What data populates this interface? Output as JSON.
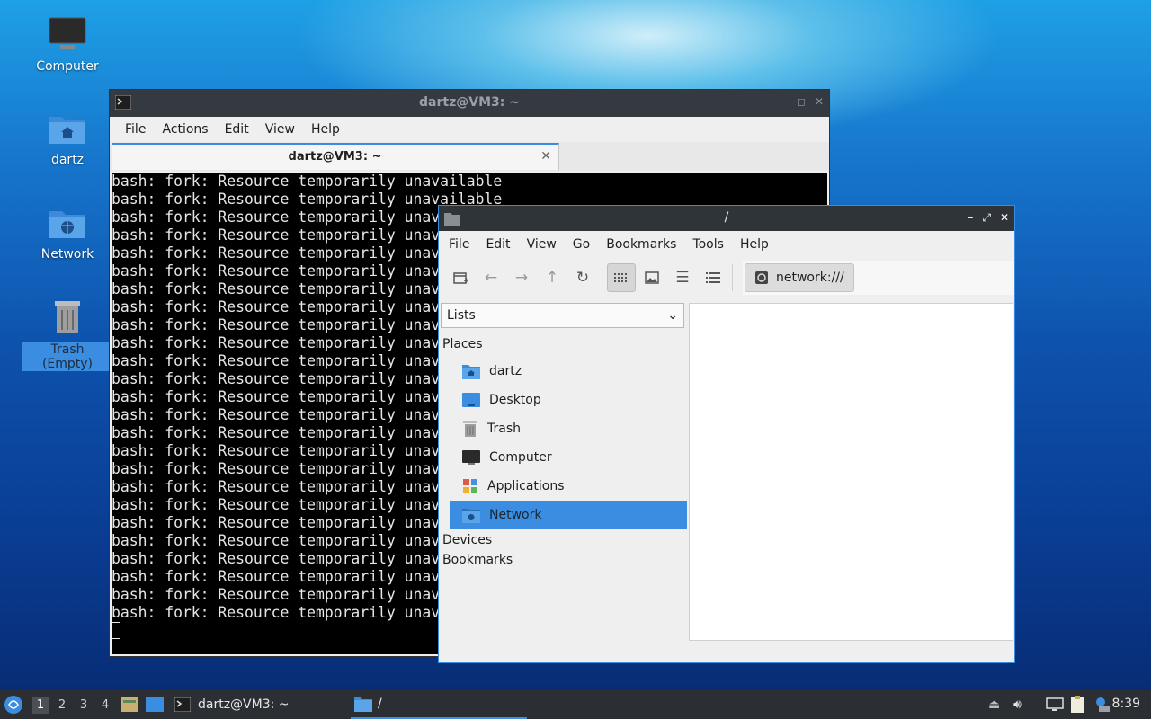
{
  "desktop": {
    "icons": [
      {
        "label": "Computer",
        "icon": "computer-icon"
      },
      {
        "label": "dartz",
        "icon": "home-folder-icon"
      },
      {
        "label": "Network",
        "icon": "network-folder-icon"
      },
      {
        "label": "Trash (Empty)",
        "icon": "trash-icon"
      }
    ]
  },
  "terminal": {
    "window_title": "dartz@VM3: ~",
    "menu": [
      "File",
      "Actions",
      "Edit",
      "View",
      "Help"
    ],
    "tab_label": "dartz@VM3: ~",
    "output_line": "bash: fork: Resource temporarily unavailable",
    "output_line_count": 25
  },
  "file_manager": {
    "window_title": "/",
    "menu": [
      "File",
      "Edit",
      "View",
      "Go",
      "Bookmarks",
      "Tools",
      "Help"
    ],
    "path": "network:///",
    "side_pane_mode": "Lists",
    "places_header": "Places",
    "places": [
      {
        "label": "dartz",
        "icon": "home-folder-icon"
      },
      {
        "label": "Desktop",
        "icon": "desktop-icon"
      },
      {
        "label": "Trash",
        "icon": "trash-icon"
      },
      {
        "label": "Computer",
        "icon": "computer-icon"
      },
      {
        "label": "Applications",
        "icon": "applications-icon"
      },
      {
        "label": "Network",
        "icon": "network-icon",
        "selected": true
      }
    ],
    "devices_header": "Devices",
    "bookmarks_header": "Bookmarks"
  },
  "taskbar": {
    "workspaces": [
      "1",
      "2",
      "3",
      "4"
    ],
    "current_workspace": "1",
    "tasks": [
      {
        "label": "dartz@VM3: ~",
        "icon": "terminal-icon"
      },
      {
        "label": "/",
        "icon": "folder-icon",
        "active": true
      }
    ],
    "clock": "8:39"
  },
  "colors": {
    "accent": "#3a8de0",
    "titlebar": "#343a40",
    "taskbar": "#2b2f33"
  }
}
